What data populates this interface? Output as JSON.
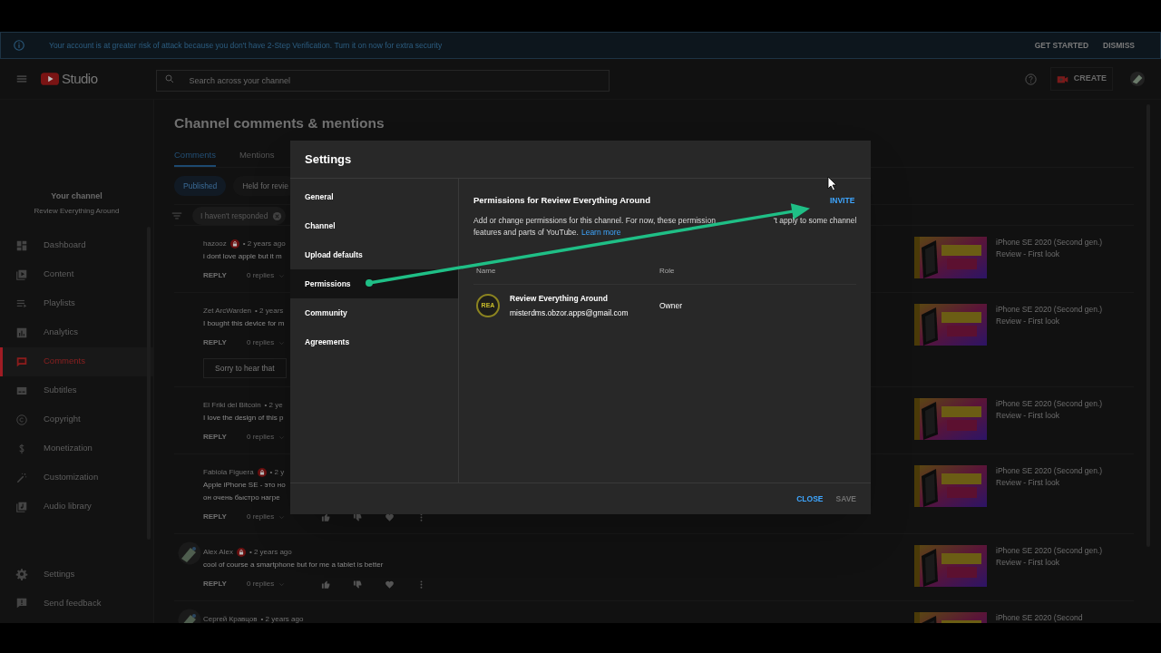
{
  "banner": {
    "message": "Your account is at greater risk of attack because you don't have 2-Step Verification. Turn it on now for extra security",
    "actions": [
      "GET STARTED",
      "DISMISS"
    ]
  },
  "header": {
    "logo_text": "Studio",
    "search": {
      "placeholder": "Search across your channel"
    },
    "create_label": "CREATE"
  },
  "sidebar": {
    "channel_title": "Your channel",
    "channel_name": "Review Everything Around",
    "items": [
      {
        "label": "Dashboard",
        "selected": false
      },
      {
        "label": "Content",
        "selected": false
      },
      {
        "label": "Playlists",
        "selected": false
      },
      {
        "label": "Analytics",
        "selected": false
      },
      {
        "label": "Comments",
        "selected": true
      },
      {
        "label": "Subtitles",
        "selected": false
      },
      {
        "label": "Copyright",
        "selected": false
      },
      {
        "label": "Monetization",
        "selected": false
      },
      {
        "label": "Customization",
        "selected": false
      },
      {
        "label": "Audio library",
        "selected": false
      }
    ],
    "footer_items": [
      "Settings",
      "Send feedback"
    ]
  },
  "page": {
    "title": "Channel comments & mentions",
    "tabs": [
      {
        "label": "Comments",
        "selected": true
      },
      {
        "label": "Mentions",
        "selected": false
      }
    ],
    "chips": [
      {
        "label": "Published",
        "selected": true
      },
      {
        "label": "Held for revie",
        "selected": false
      }
    ],
    "filter_chip": "I haven't responded",
    "comments": [
      {
        "kind": "covered",
        "avatar": false,
        "author": "hazooz",
        "badge": true,
        "time": "• 2 years ago",
        "text": [
          "i dont love apple but it m"
        ],
        "reply": "REPLY",
        "replies": "0 replies",
        "video_title": "iPhone SE 2020 (Second gen.) Review - First look"
      },
      {
        "kind": "covered",
        "avatar": false,
        "author": "Zet ArcWarden",
        "badge": false,
        "time": "• 2 years",
        "text": [
          "I bought this device for m"
        ],
        "reply": "REPLY",
        "replies": "0 replies",
        "suggestions": [
          "Sorry to hear that"
        ],
        "video_title": "iPhone SE 2020 (Second gen.) Review - First look"
      },
      {
        "kind": "covered",
        "avatar": false,
        "author": "El Friki del Bitcoin",
        "badge": false,
        "time": "• 2 ye",
        "text": [
          "I love the design of this p"
        ],
        "reply": "REPLY",
        "replies": "0 replies",
        "video_title": "iPhone SE 2020 (Second gen.) Review - First look"
      },
      {
        "kind": "full",
        "avatar": false,
        "author": "Fabiola Figuera",
        "badge": true,
        "time": "• 2 y",
        "text": [
          "Apple iPhone SE - это но",
          "он очень быстро нагре"
        ],
        "reply": "REPLY",
        "replies": "0 replies",
        "video_title": "iPhone SE 2020 (Second gen.) Review - First look"
      },
      {
        "kind": "full",
        "avatar": true,
        "author": "Alex Alex",
        "badge": true,
        "time": "• 2 years ago",
        "text": [
          "cool of course a smartphone but for me a tablet is better"
        ],
        "reply": "REPLY",
        "replies": "0 replies",
        "video_title": "iPhone SE 2020 (Second gen.) Review - First look"
      },
      {
        "kind": "cut",
        "avatar": true,
        "author": "Сергей Кравцов",
        "badge": false,
        "time": "• 2 years ago",
        "video_title": "iPhone SE 2020 (Second"
      }
    ]
  },
  "dialog": {
    "title": "Settings",
    "nav": [
      {
        "label": "General",
        "selected": false
      },
      {
        "label": "Channel",
        "selected": false
      },
      {
        "label": "Upload defaults",
        "selected": false
      },
      {
        "label": "Permissions",
        "selected": true
      },
      {
        "label": "Community",
        "selected": false
      },
      {
        "label": "Agreements",
        "selected": false
      }
    ],
    "heading": "Permissions for Review Everything Around",
    "invite": "INVITE",
    "description": [
      "Add or change permissions for this channel. For now, these permission",
      "'t apply to some channel",
      "features and parts of YouTube."
    ],
    "learn_more": "Learn more",
    "columns": [
      "Name",
      "Role"
    ],
    "members": [
      {
        "initials": "REA",
        "name": "Review Everything Around",
        "email": "misterdms.obzor.apps@gmail.com",
        "role": "Owner"
      }
    ],
    "buttons": [
      {
        "label": "CLOSE",
        "disabled": false
      },
      {
        "label": "SAVE",
        "disabled": true
      }
    ]
  }
}
